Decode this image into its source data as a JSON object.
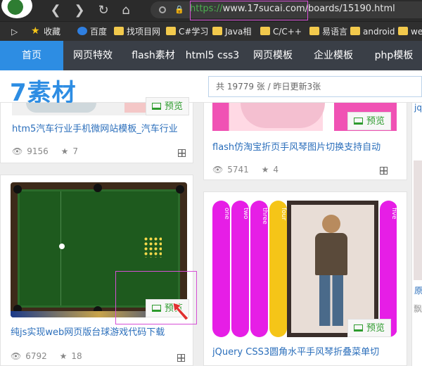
{
  "browser": {
    "url_protocol": "https://",
    "url_rest": "www.17sucai.com/boards/15190.html",
    "accent_highlight": "#d64fd6"
  },
  "bookmarks": [
    {
      "label": "收藏",
      "icon": "star-icon"
    },
    {
      "label": "百度",
      "icon": "baidu-icon"
    },
    {
      "label": "找项目网",
      "icon": "folder-icon"
    },
    {
      "label": "C#学习",
      "icon": "folder-icon"
    },
    {
      "label": "Java相",
      "icon": "folder-icon"
    },
    {
      "label": "C/C++",
      "icon": "folder-icon"
    },
    {
      "label": "易语言",
      "icon": "folder-icon"
    },
    {
      "label": "android",
      "icon": "folder-icon"
    },
    {
      "label": "we",
      "icon": "folder-icon"
    }
  ],
  "sitenav": {
    "items": [
      "首页",
      "网页特效",
      "flash素材",
      "html5 css3",
      "网页模板",
      "企业模板",
      "php模板"
    ],
    "active_color": "#2d8de3"
  },
  "header": {
    "logo": "7素材",
    "search_placeholder": "共 19779 张 / 昨日更新3张"
  },
  "cards": [
    {
      "title": "htm5汽车行业手机微网站模板_汽车行业",
      "views": "9156",
      "stars": "7",
      "preview_label": "预览"
    },
    {
      "title": "flash仿淘宝折页手风琴图片切换支持自动",
      "views": "5741",
      "stars": "4",
      "preview_label": "预览"
    },
    {
      "title": "纯js实现web网页版台球游戏代码下载",
      "views": "6792",
      "stars": "18",
      "preview_label": "预览"
    },
    {
      "title": "jQuery CSS3圆角水平手风琴折叠菜单切",
      "preview_label": "预览",
      "accordion_labels": [
        "one",
        "two",
        "three",
        "four",
        "five"
      ]
    }
  ],
  "right_peek": {
    "top_text": "jq",
    "mid_text": "原",
    "bottom_text": "飘"
  }
}
